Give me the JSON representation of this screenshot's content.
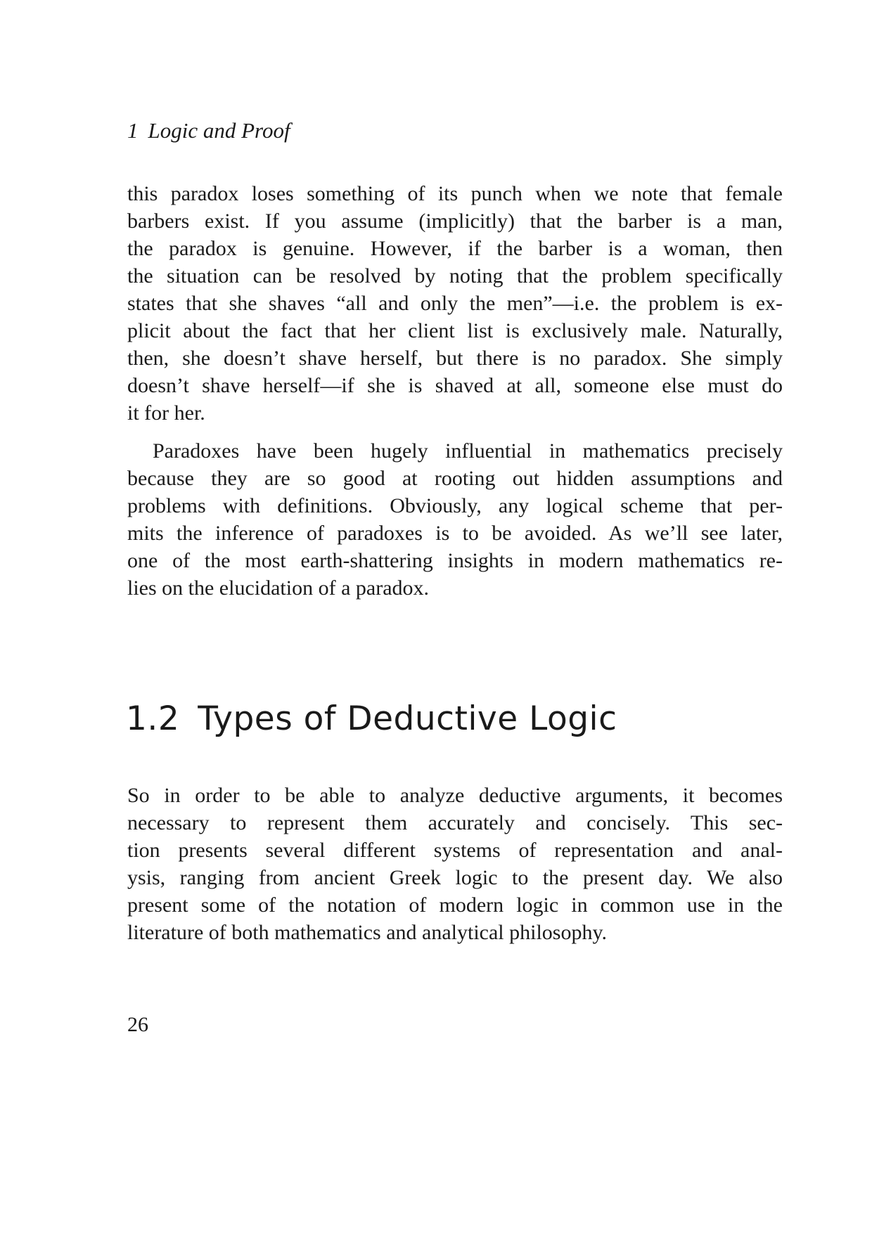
{
  "running_head": {
    "chapter_number": "1",
    "chapter_title": "Logic and Proof"
  },
  "paragraphs": [
    {
      "lines": [
        "this paradox loses something of its punch when we note that female",
        "barbers exist. If you assume (implicitly) that the barber is a man,",
        "the paradox is genuine. However, if the barber is a woman, then",
        "the situation can be resolved by noting that the problem specifically",
        "states that she shaves “all and only the men”—i.e. the problem is ex-",
        "plicit about the fact that her client list is exclusively male. Naturally,",
        "then, she doesn’t shave herself, but there is no paradox. She simply",
        "doesn’t shave herself—if she is shaved at all, someone else must do",
        "it for her."
      ]
    },
    {
      "lines": [
        "Paradoxes have been hugely influential in mathematics precisely",
        "because they are so good at rooting out hidden assumptions and",
        "problems with definitions. Obviously, any logical scheme that per-",
        "mits the inference of paradoxes is to be avoided. As we’ll see later,",
        "one of the most earth-shattering insights in modern mathematics re-",
        "lies on the elucidation of a paradox."
      ]
    },
    {
      "lines": [
        "So in order to be able to analyze deductive arguments, it becomes",
        "necessary to represent them accurately and concisely. This sec-",
        "tion presents several different systems of representation and anal-",
        "ysis, ranging from ancient Greek logic to the present day. We also",
        "present some of the notation of modern logic in common use in the",
        "literature of both mathematics and analytical philosophy."
      ]
    }
  ],
  "section": {
    "number": "1.2",
    "title": "Types of Deductive Logic"
  },
  "page_number": "26"
}
